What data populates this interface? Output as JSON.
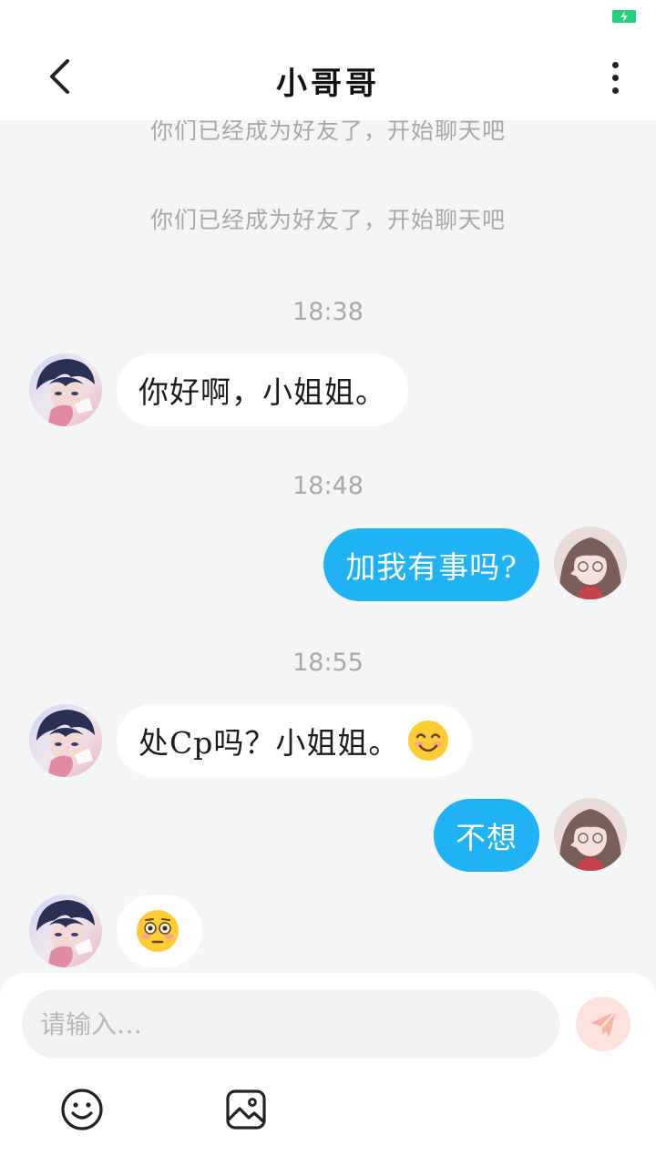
{
  "header": {
    "title": "小哥哥"
  },
  "chat": {
    "system_notes": [
      "你们已经成为好友了，开始聊天吧",
      "你们已经成为好友了，开始聊天吧"
    ],
    "timestamps": [
      "18:38",
      "18:48",
      "18:55"
    ],
    "messages": [
      {
        "side": "in",
        "text": "你好啊，小姐姐。"
      },
      {
        "side": "out",
        "text": "加我有事吗?"
      },
      {
        "side": "in",
        "text": "处Cp吗？小姐姐。",
        "emoji": "smiling-face"
      },
      {
        "side": "out",
        "text": "不想"
      },
      {
        "side": "in",
        "text": "",
        "emoji": "flushed-face"
      }
    ]
  },
  "input": {
    "placeholder": "请输入…"
  },
  "colors": {
    "outgoing_bubble": "#1fb3f5",
    "incoming_bubble": "#ffffff",
    "background": "#f4f5f7",
    "send_button": "#fde3dc",
    "battery": "#21d07a"
  },
  "icons": [
    "battery-charging-icon",
    "back-arrow-icon",
    "more-vertical-icon",
    "send-icon",
    "emoji-icon",
    "image-icon"
  ]
}
